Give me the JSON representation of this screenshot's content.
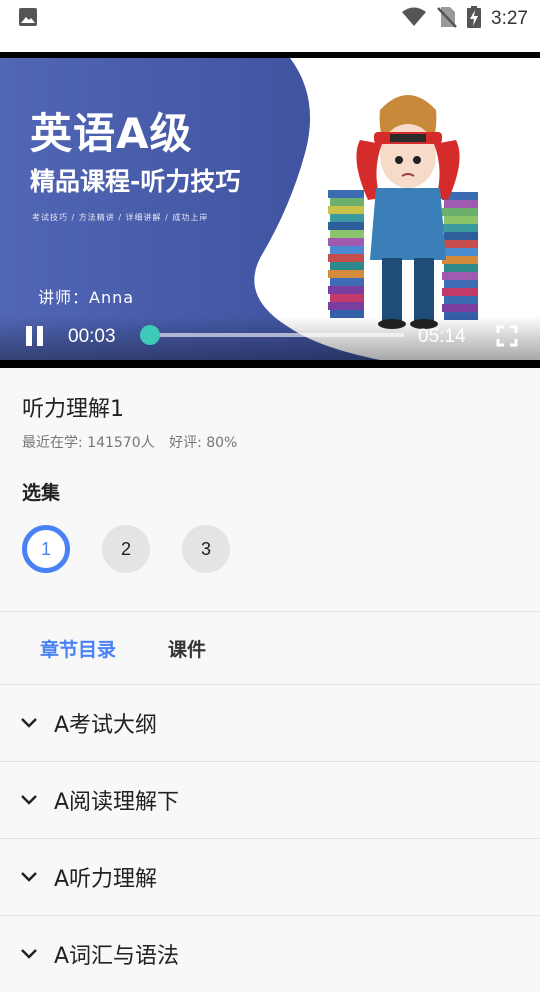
{
  "status_bar": {
    "time": "3:27",
    "icons": [
      "image-icon",
      "wifi-icon",
      "no-sim-icon",
      "battery-charging-icon"
    ]
  },
  "video": {
    "title": "英语A级",
    "subtitle": "精品课程-听力技巧",
    "tags": "考试技巧 / 方法精讲 / 详细讲解 / 成功上岸",
    "teacher": "讲师：Anna",
    "current_time": "00:03",
    "total_time": "05:14",
    "progress_fraction": 0.0096,
    "accent_color": "#3ec9b8"
  },
  "lesson": {
    "title": "听力理解1",
    "learners": "最近在学: 141570人",
    "rating": "好评: 80%"
  },
  "episodes": {
    "label": "选集",
    "items": [
      "1",
      "2",
      "3"
    ],
    "selected": "1"
  },
  "tabs": [
    {
      "label": "章节目录",
      "active": true
    },
    {
      "label": "课件",
      "active": false
    }
  ],
  "chapters": [
    "A考试大纲",
    "A阅读理解下",
    "A听力理解",
    "A词汇与语法"
  ],
  "colors": {
    "primary": "#4a82f5",
    "video_bg": "#4358a6"
  }
}
